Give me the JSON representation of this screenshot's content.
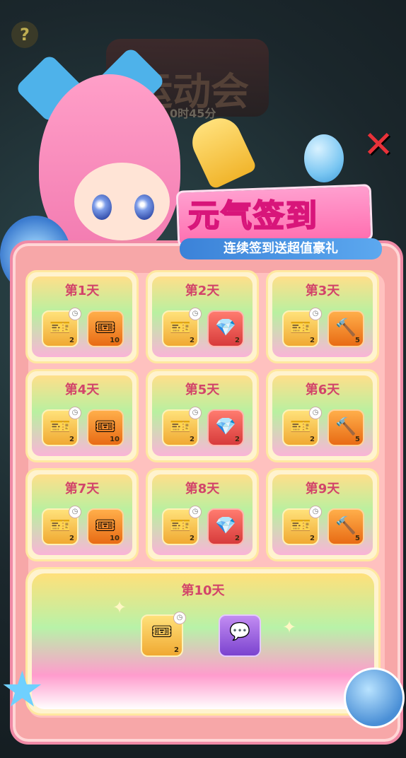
{
  "background": {
    "event_banner_text": "运动会",
    "event_timer_text": "0时45分"
  },
  "help_icon": "question-icon",
  "title": {
    "main": "元气签到",
    "subtitle": "连续签到送超值豪礼"
  },
  "colors": {
    "panel": "#f7a7a8",
    "title_pink": "#ff6fb0",
    "subtitle_blue": "#3b82d8",
    "day_label": "#d2446a",
    "close": "#e8323a"
  },
  "days": [
    {
      "label": "第1天",
      "items": [
        {
          "icon": "ticket-pink-icon",
          "color": "yellow",
          "count": "2"
        },
        {
          "icon": "ticket-orange-icon",
          "color": "orange",
          "count": "10"
        }
      ]
    },
    {
      "label": "第2天",
      "items": [
        {
          "icon": "ticket-pink-icon",
          "color": "yellow",
          "count": "2"
        },
        {
          "icon": "gem-icon",
          "color": "red",
          "count": "2"
        }
      ]
    },
    {
      "label": "第3天",
      "items": [
        {
          "icon": "ticket-pink-icon",
          "color": "yellow",
          "count": "2"
        },
        {
          "icon": "hammer-icon",
          "color": "orange",
          "count": "5"
        }
      ]
    },
    {
      "label": "第4天",
      "items": [
        {
          "icon": "ticket-pink-icon",
          "color": "yellow",
          "count": "2"
        },
        {
          "icon": "ticket-orange-icon",
          "color": "orange",
          "count": "10"
        }
      ]
    },
    {
      "label": "第5天",
      "items": [
        {
          "icon": "ticket-pink-icon",
          "color": "yellow",
          "count": "2"
        },
        {
          "icon": "gem-icon",
          "color": "red",
          "count": "2"
        }
      ]
    },
    {
      "label": "第6天",
      "items": [
        {
          "icon": "ticket-pink-icon",
          "color": "yellow",
          "count": "2"
        },
        {
          "icon": "hammer-icon",
          "color": "orange",
          "count": "5"
        }
      ]
    },
    {
      "label": "第7天",
      "items": [
        {
          "icon": "ticket-pink-icon",
          "color": "yellow",
          "count": "2"
        },
        {
          "icon": "ticket-orange-icon",
          "color": "orange",
          "count": "10"
        }
      ]
    },
    {
      "label": "第8天",
      "items": [
        {
          "icon": "ticket-pink-icon",
          "color": "yellow",
          "count": "2"
        },
        {
          "icon": "gem-icon",
          "color": "red",
          "count": "2"
        }
      ]
    },
    {
      "label": "第9天",
      "items": [
        {
          "icon": "ticket-pink-icon",
          "color": "yellow",
          "count": "2"
        },
        {
          "icon": "hammer-icon",
          "color": "orange",
          "count": "5"
        }
      ]
    }
  ],
  "final_day": {
    "label": "第10天",
    "items": [
      {
        "icon": "ticket-gold-icon",
        "color": "yellow",
        "count": "2"
      },
      {
        "icon": "chat-bubble-frame-icon",
        "color": "purple",
        "count": ""
      }
    ]
  }
}
